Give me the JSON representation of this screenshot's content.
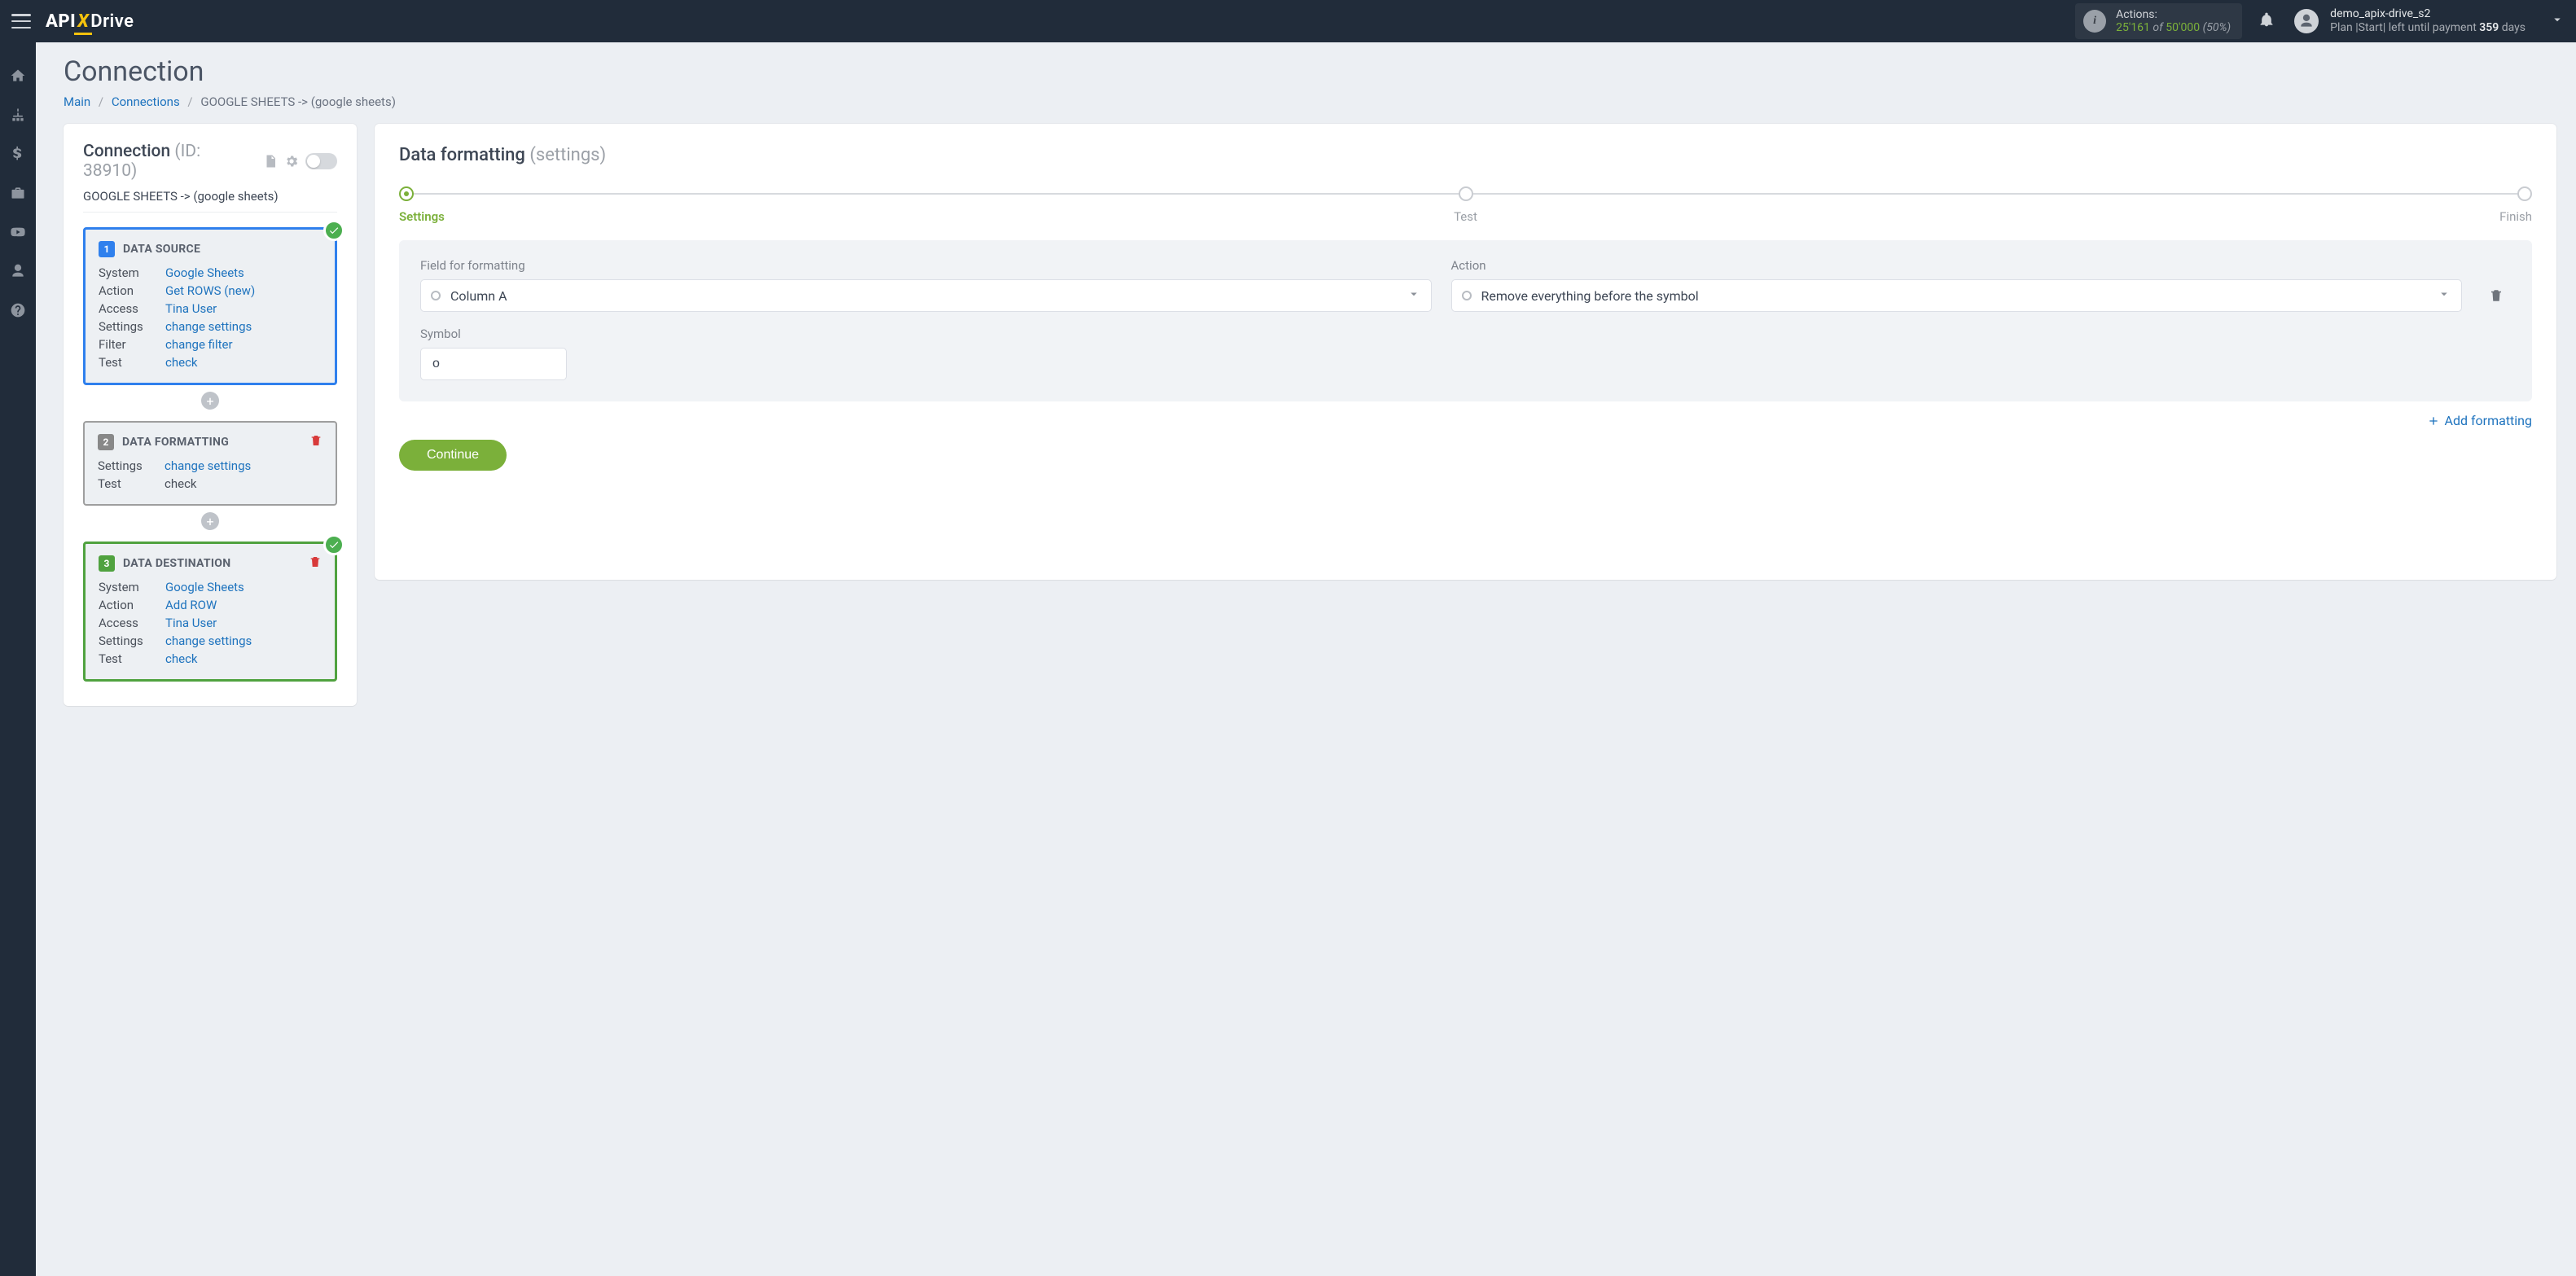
{
  "header": {
    "logo": {
      "part1": "API",
      "part2": "X",
      "part3": "Drive"
    },
    "actions": {
      "label": "Actions:",
      "current": "25'161",
      "of_word": "of",
      "total": "50'000",
      "percent": "(50%)"
    },
    "user": {
      "name": "demo_apix-drive_s2",
      "plan_prefix": "Plan |Start| left until payment ",
      "days_num": "359",
      "days_word": " days"
    }
  },
  "leftnav": [
    "home",
    "sitemap",
    "dollar",
    "briefcase",
    "youtube",
    "user",
    "help"
  ],
  "page": {
    "title": "Connection",
    "breadcrumb": {
      "main": "Main",
      "connections": "Connections",
      "current": "GOOGLE SHEETS -> (google sheets)"
    }
  },
  "left_panel": {
    "title": "Connection",
    "id_label": "(ID: 38910)",
    "subtitle": "GOOGLE SHEETS -> (google sheets)",
    "source": {
      "num": "1",
      "title": "DATA SOURCE",
      "rows": [
        {
          "k": "System",
          "v": "Google Sheets",
          "link": true
        },
        {
          "k": "Action",
          "v": "Get ROWS (new)",
          "link": true
        },
        {
          "k": "Access",
          "v": "Tina User",
          "link": true
        },
        {
          "k": "Settings",
          "v": "change settings",
          "link": true
        },
        {
          "k": "Filter",
          "v": "change filter",
          "link": true
        },
        {
          "k": "Test",
          "v": "check",
          "link": true
        }
      ]
    },
    "formatting": {
      "num": "2",
      "title": "DATA FORMATTING",
      "rows": [
        {
          "k": "Settings",
          "v": "change settings",
          "link": true
        },
        {
          "k": "Test",
          "v": "check",
          "link": false
        }
      ]
    },
    "destination": {
      "num": "3",
      "title": "DATA DESTINATION",
      "rows": [
        {
          "k": "System",
          "v": "Google Sheets",
          "link": true
        },
        {
          "k": "Action",
          "v": "Add ROW",
          "link": true
        },
        {
          "k": "Access",
          "v": "Tina User",
          "link": true
        },
        {
          "k": "Settings",
          "v": "change settings",
          "link": true
        },
        {
          "k": "Test",
          "v": "check",
          "link": true
        }
      ]
    }
  },
  "right_panel": {
    "title": "Data formatting ",
    "title_sub": "(settings)",
    "steps": [
      {
        "label": "Settings",
        "active": true
      },
      {
        "label": "Test",
        "active": false
      },
      {
        "label": "Finish",
        "active": false
      }
    ],
    "form": {
      "field_label": "Field for formatting",
      "field_value": "Column A",
      "action_label": "Action",
      "action_value": "Remove everything before the symbol",
      "symbol_label": "Symbol",
      "symbol_value": "o"
    },
    "add_formatting": "Add formatting",
    "continue": "Continue"
  }
}
